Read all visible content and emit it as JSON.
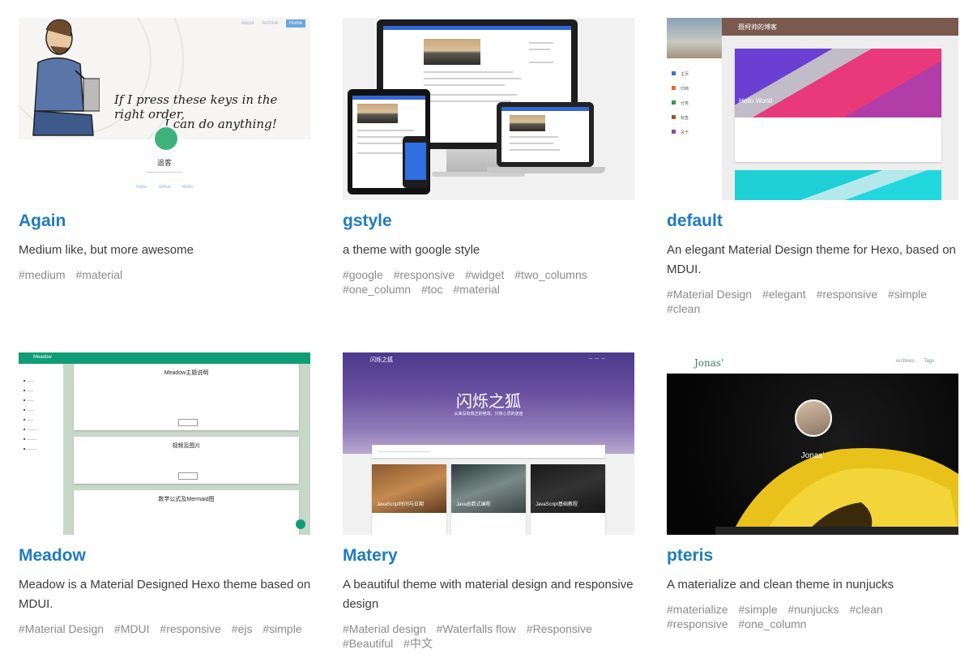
{
  "cards": [
    {
      "title": "Again",
      "description": "Medium like, but more awesome",
      "tags": [
        "#medium",
        "#material"
      ],
      "preview": {
        "nav": [
          "About",
          "Archive",
          "Home"
        ],
        "quote_line1": "If I press these keys in the right order,",
        "quote_line2": "I can do anything!",
        "name": "追客",
        "links": [
          "Twitter",
          "GitHub",
          "Weibo"
        ]
      }
    },
    {
      "title": "gstyle",
      "description": "a theme with google style",
      "tags": [
        "#google",
        "#responsive",
        "#widget",
        "#two_columns",
        "#one_column",
        "#toc",
        "#material"
      ]
    },
    {
      "title": "default",
      "description": "An elegant Material Design theme for Hexo, based on MDUI.",
      "tags": [
        "#Material Design",
        "#elegant",
        "#responsive",
        "#simple",
        "#clean"
      ],
      "preview": {
        "blog_title": "聂柯帅的博客",
        "menu": [
          "主页",
          "归档",
          "分类",
          "标签",
          "关于"
        ],
        "post_title": "Hello World"
      }
    },
    {
      "title": "Meadow",
      "description": "Meadow is a Material Designed Hexo theme based on MDUI.",
      "tags": [
        "#Material Design",
        "#MDUI",
        "#responsive",
        "#ejs",
        "#simple"
      ],
      "preview": {
        "app_title": "Meadow",
        "posts": [
          "Meadow主题说明",
          "视频及图片",
          "数学公式及Mermaid图"
        ]
      }
    },
    {
      "title": "Matery",
      "description": "A beautiful theme with material design and responsive design",
      "tags": [
        "#Material design",
        "#Waterfalls flow",
        "#Responsive",
        "#Beautiful",
        "#中文"
      ],
      "preview": {
        "logo": "闪烁之狐",
        "hero": "闪烁之狐",
        "hero_sub": "从来没有真正的绝境，只有心灵的迷途",
        "posts": [
          "JavaScript时间与日期",
          "Java函数式编程",
          "JavaScript基础教程"
        ]
      }
    },
    {
      "title": "pteris",
      "description": "A materialize and clean theme in nunjucks",
      "tags": [
        "#materialize",
        "#simple",
        "#nunjucks",
        "#clean",
        "#responsive",
        "#one_column"
      ],
      "preview": {
        "site_name": "Jonas'",
        "links": [
          "Archives",
          "Tags"
        ],
        "author": "Jonas'"
      }
    }
  ]
}
